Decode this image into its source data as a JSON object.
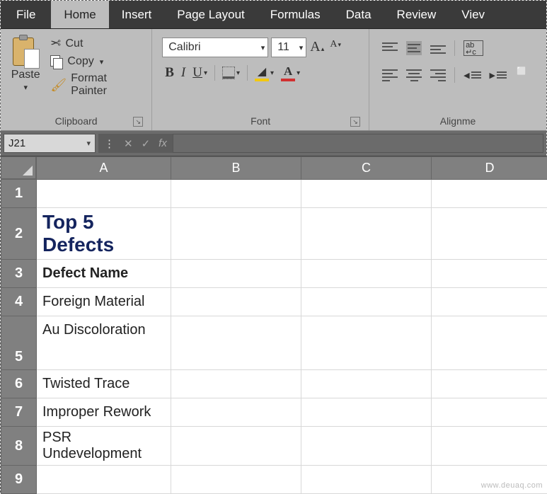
{
  "tabs": {
    "file": "File",
    "home": "Home",
    "insert": "Insert",
    "page_layout": "Page Layout",
    "formulas": "Formulas",
    "data": "Data",
    "review": "Review",
    "view": "Viev"
  },
  "ribbon": {
    "clipboard": {
      "label": "Clipboard",
      "paste": "Paste",
      "cut": "Cut",
      "copy": "Copy",
      "format_painter": "Format Painter"
    },
    "font": {
      "label": "Font",
      "name": "Calibri",
      "size": "11",
      "bold": "B",
      "italic": "I",
      "underline": "U",
      "font_color_letter": "A",
      "increase_A": "A",
      "decrease_A": "A"
    },
    "alignment": {
      "label": "Alignme"
    }
  },
  "formula_bar": {
    "name_box": "J21",
    "cancel": "✕",
    "enter": "✓",
    "fx": "fx"
  },
  "columns": [
    "A",
    "B",
    "C",
    "D"
  ],
  "rows": [
    {
      "num": "1",
      "A": ""
    },
    {
      "num": "2",
      "A": "Top 5 Defects",
      "style": "title"
    },
    {
      "num": "3",
      "A": "Defect Name",
      "style": "bold"
    },
    {
      "num": "4",
      "A": "Foreign Material"
    },
    {
      "num": "5",
      "A": "Au Discoloration",
      "tall": true
    },
    {
      "num": "6",
      "A": "Twisted Trace"
    },
    {
      "num": "7",
      "A": "Improper Rework"
    },
    {
      "num": "8",
      "A": "PSR Undevelopment"
    },
    {
      "num": "9",
      "A": ""
    }
  ],
  "watermark": "www.deuaq.com"
}
